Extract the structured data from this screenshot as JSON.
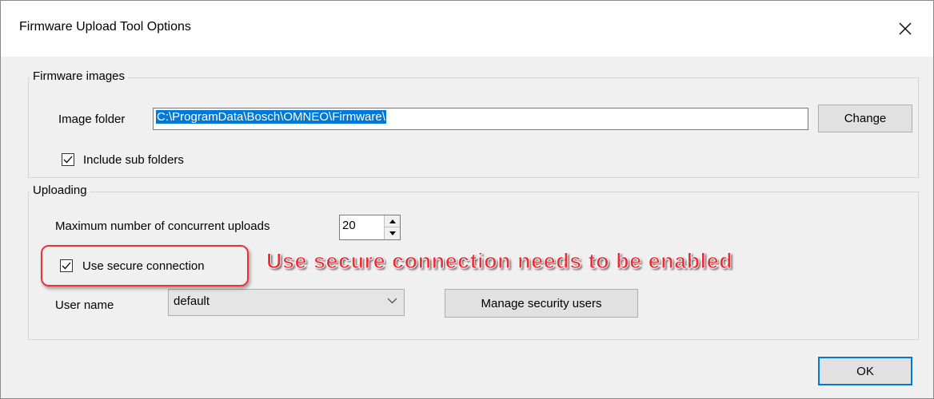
{
  "window": {
    "title": "Firmware Upload Tool Options",
    "close_icon": "close-icon"
  },
  "firmware_group": {
    "title": "Firmware images",
    "image_folder_label": "Image folder",
    "image_folder_value": "C:\\ProgramData\\Bosch\\OMNEO\\Firmware\\",
    "change_label": "Change",
    "include_subfolders_label": "Include sub folders",
    "include_subfolders_checked": true
  },
  "uploading_group": {
    "title": "Uploading",
    "max_concurrent_label": "Maximum number of concurrent uploads",
    "max_concurrent_value": "20",
    "secure_connection_label": "Use secure connection",
    "secure_connection_checked": true,
    "user_name_label": "User name",
    "user_name_value": "default",
    "manage_users_label": "Manage security users"
  },
  "annotation": {
    "text": "Use secure connection needs to be enabled",
    "color": "#ef2b34"
  },
  "footer": {
    "ok_label": "OK"
  },
  "colors": {
    "accent": "#0078d7",
    "annotation": "#ef2b34"
  }
}
